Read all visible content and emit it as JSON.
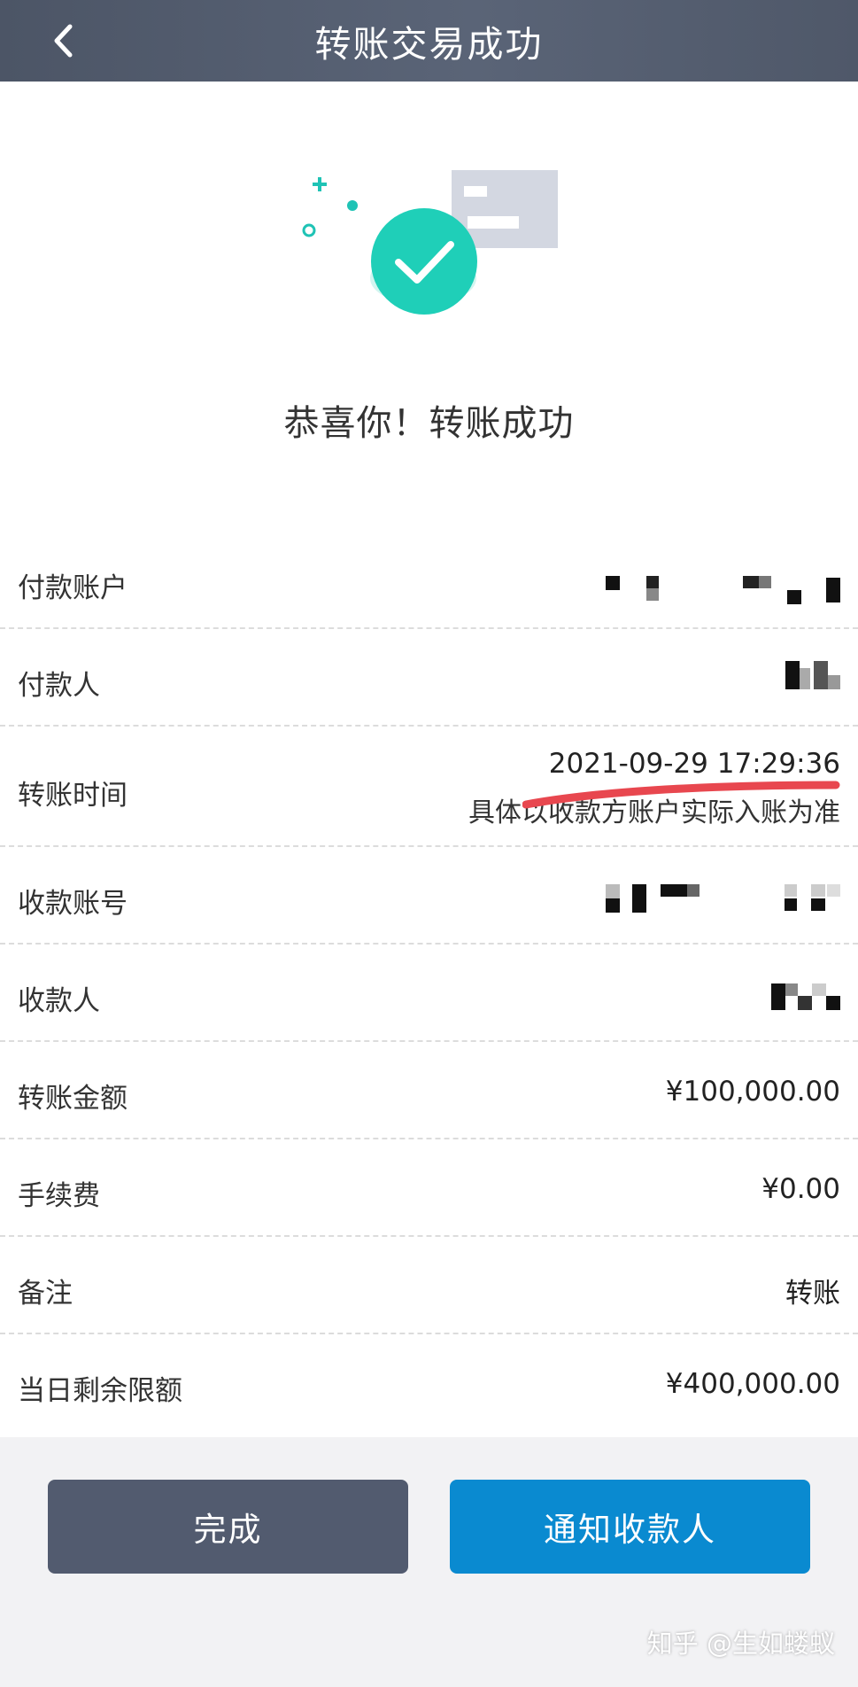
{
  "nav": {
    "title": "转账交易成功",
    "back_icon": "chevron-left-icon"
  },
  "hero": {
    "icon": "check-circle-icon",
    "accent_color": "#1fcfb8"
  },
  "success_message": "恭喜你！转账成功",
  "details": {
    "payer_account": {
      "label": "付款账户",
      "value": ""
    },
    "payer": {
      "label": "付款人",
      "value": ""
    },
    "transfer_time": {
      "label": "转账时间",
      "value": "2021-09-29 17:29:36",
      "note": "具体以收款方账户实际入账为准"
    },
    "payee_account": {
      "label": "收款账号",
      "value": ""
    },
    "payee": {
      "label": "收款人",
      "value": ""
    },
    "amount": {
      "label": "转账金额",
      "value": "¥100,000.00"
    },
    "fee": {
      "label": "手续费",
      "value": "¥0.00"
    },
    "remark": {
      "label": "备注",
      "value": "转账"
    },
    "daily_limit": {
      "label": "当日剩余限额",
      "value": "¥400,000.00"
    }
  },
  "buttons": {
    "done": "完成",
    "notify_payee": "通知收款人"
  },
  "watermark": "知乎 @生如蝼蚁"
}
